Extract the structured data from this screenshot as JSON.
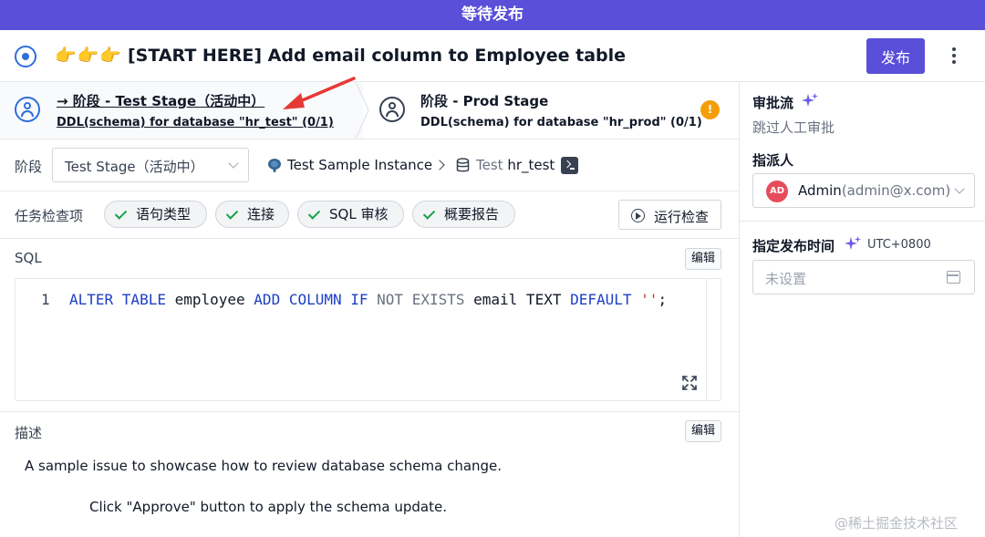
{
  "banner": {
    "text": "等待发布"
  },
  "header": {
    "title_emoji": "👉👉👉",
    "title": "[START HERE] Add email column to Employee table",
    "publish_label": "发布"
  },
  "stages": [
    {
      "name": "→ 阶段 - Test Stage（活动中）",
      "sub": "DDL(schema) for database \"hr_test\" (0/1)"
    },
    {
      "name": "阶段 - Prod Stage",
      "sub": "DDL(schema) for database \"hr_prod\" (0/1)",
      "badge": "!"
    }
  ],
  "stage_row": {
    "label": "阶段",
    "selected": "Test Stage（活动中）",
    "instance": "Test Sample Instance",
    "db_env": "Test",
    "db_name": "hr_test"
  },
  "checks": {
    "label": "任务检查项",
    "items": [
      "语句类型",
      "连接",
      "SQL 审核",
      "概要报告"
    ],
    "run_label": "运行检查"
  },
  "sql": {
    "label": "SQL",
    "edit_label": "编辑",
    "line_number": "1",
    "tokens": {
      "t1": "ALTER TABLE",
      "t2": " employee ",
      "t3": "ADD COLUMN IF",
      "t4": " NOT EXISTS",
      "t5": " email TEXT ",
      "t6": "DEFAULT",
      "t7": " ''",
      "t8": ";"
    }
  },
  "description": {
    "label": "描述",
    "edit_label": "编辑",
    "line1": "A sample issue to showcase how to review database schema change.",
    "line2": "Click \"Approve\" button to apply the schema update."
  },
  "sidebar": {
    "approval_title": "审批流",
    "approval_value": "跳过人工审批",
    "assignee_title": "指派人",
    "assignee_initials": "AD",
    "assignee_name": "Admin",
    "assignee_email": "(admin@x.com)",
    "schedule_title": "指定发布时间",
    "timezone": "UTC+0800",
    "schedule_placeholder": "未设置"
  },
  "watermark": "@稀土掘金技术社区",
  "colors": {
    "brand": "#5a4fd8",
    "accent": "#2f6fdb",
    "success": "#16a34a",
    "warning": "#f59e0b",
    "annotation": "#e53935"
  }
}
